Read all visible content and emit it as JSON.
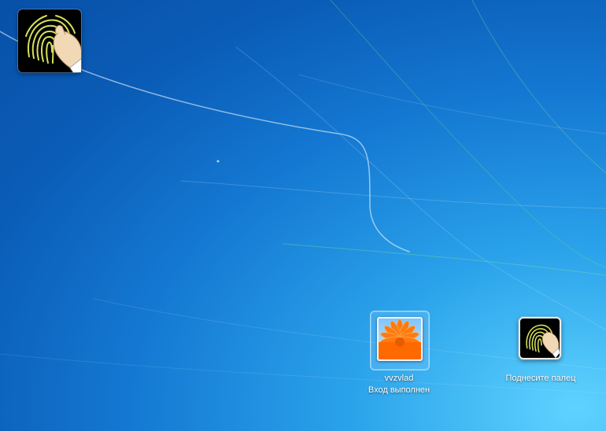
{
  "colors": {
    "background_top": "#0850a8",
    "background_bottom_right": "#5fd3ff",
    "fingerprint": "#d6e05a",
    "text": "#ffffff"
  },
  "icons": {
    "large_fingerprint": "fingerprint-hand-icon",
    "avatar": "orange-flower-avatar",
    "small_fingerprint": "fingerprint-hand-icon"
  },
  "user_tile": {
    "username": "vvzvlad",
    "status": "Вход выполнен"
  },
  "fingerprint_tile": {
    "label": "Поднесите палец"
  }
}
